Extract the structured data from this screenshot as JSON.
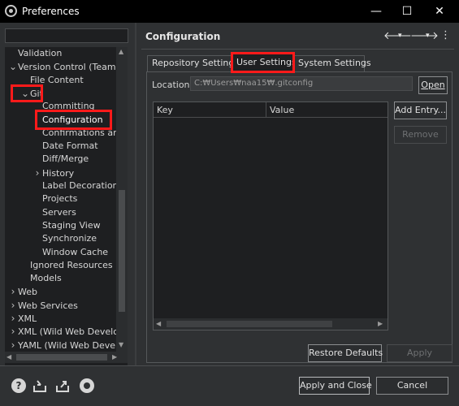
{
  "window": {
    "title": "Preferences",
    "minimize_glyph": "—",
    "maximize_glyph": "☐",
    "close_glyph": "✕"
  },
  "sidebar": {
    "filter_value": "",
    "items": [
      {
        "label": "Validation",
        "indent": 1,
        "twisty": ""
      },
      {
        "label": "Version Control (Team)",
        "indent": 1,
        "twisty": "expanded"
      },
      {
        "label": "File Content",
        "indent": 2,
        "twisty": ""
      },
      {
        "label": "Git",
        "indent": 2,
        "twisty": "expanded"
      },
      {
        "label": "Committing",
        "indent": 3,
        "twisty": ""
      },
      {
        "label": "Configuration",
        "indent": 3,
        "twisty": "",
        "selected": true
      },
      {
        "label": "Confirmations and",
        "indent": 3,
        "twisty": ""
      },
      {
        "label": "Date Format",
        "indent": 3,
        "twisty": ""
      },
      {
        "label": "Diff/Merge",
        "indent": 3,
        "twisty": ""
      },
      {
        "label": "History",
        "indent": 3,
        "twisty": "collapsed"
      },
      {
        "label": "Label Decorations",
        "indent": 3,
        "twisty": ""
      },
      {
        "label": "Projects",
        "indent": 3,
        "twisty": ""
      },
      {
        "label": "Servers",
        "indent": 3,
        "twisty": ""
      },
      {
        "label": "Staging View",
        "indent": 3,
        "twisty": ""
      },
      {
        "label": "Synchronize",
        "indent": 3,
        "twisty": ""
      },
      {
        "label": "Window Cache",
        "indent": 3,
        "twisty": ""
      },
      {
        "label": "Ignored Resources",
        "indent": 2,
        "twisty": ""
      },
      {
        "label": "Models",
        "indent": 2,
        "twisty": ""
      },
      {
        "label": "Web",
        "indent": 1,
        "twisty": "collapsed"
      },
      {
        "label": "Web Services",
        "indent": 1,
        "twisty": "collapsed"
      },
      {
        "label": "XML",
        "indent": 1,
        "twisty": "collapsed"
      },
      {
        "label": "XML (Wild Web Develop",
        "indent": 1,
        "twisty": "collapsed"
      },
      {
        "label": "YAML (Wild Web Develo",
        "indent": 1,
        "twisty": "collapsed"
      }
    ]
  },
  "main": {
    "title": "Configuration",
    "nav": {
      "back": "🡐",
      "forward": "🡒",
      "dropdown": "▾",
      "menu": "⋮"
    },
    "tabs": [
      {
        "label": "Repository Settings",
        "active": false
      },
      {
        "label": "User Settings",
        "active": true
      },
      {
        "label": "System Settings",
        "active": false
      }
    ],
    "location_label": "Location:",
    "location_value": "C:₩Users₩naa15₩.gitconfig",
    "open_button": "Open",
    "table": {
      "columns": [
        "Key",
        "Value"
      ],
      "rows": []
    },
    "add_entry_button": "Add Entry...",
    "remove_button": "Remove",
    "restore_defaults_button": "Restore Defaults",
    "apply_button": "Apply"
  },
  "footer": {
    "apply_close_button": "Apply and Close",
    "cancel_button": "Cancel",
    "help_glyph": "?"
  },
  "highlight_color": "#ff1a1a"
}
